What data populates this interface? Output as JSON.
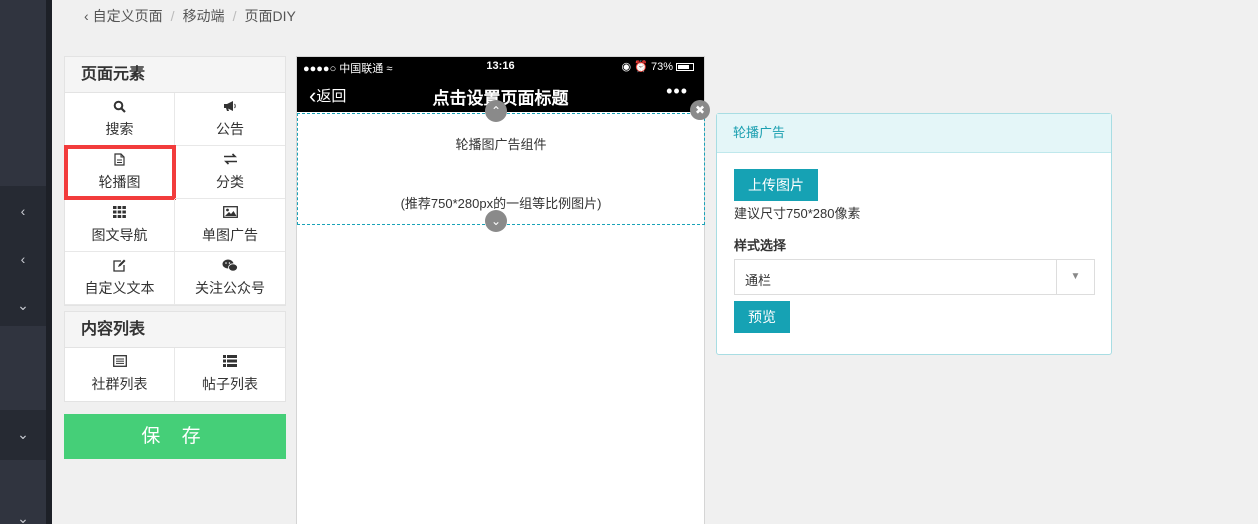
{
  "breadcrumb": {
    "back_icon": "chevron-left-icon",
    "items": [
      "自定义页面",
      "移动端",
      "页面DIY"
    ]
  },
  "page_elements": {
    "title": "页面元素",
    "items": [
      {
        "label": "搜索",
        "icon": "search-icon"
      },
      {
        "label": "公告",
        "icon": "bullhorn-icon"
      },
      {
        "label": "轮播图",
        "icon": "file-icon"
      },
      {
        "label": "分类",
        "icon": "exchange-icon"
      },
      {
        "label": "图文导航",
        "icon": "th-icon"
      },
      {
        "label": "单图广告",
        "icon": "picture-icon"
      },
      {
        "label": "自定义文本",
        "icon": "edit-icon"
      },
      {
        "label": "关注公众号",
        "icon": "wechat-icon"
      }
    ]
  },
  "content_list": {
    "title": "内容列表",
    "items": [
      {
        "label": "社群列表",
        "icon": "list-alt-icon"
      },
      {
        "label": "帖子列表",
        "icon": "list-icon"
      }
    ]
  },
  "save_label": "保 存",
  "phone": {
    "carrier": "●●●●○ 中国联通",
    "time": "13:16",
    "battery": "73%",
    "back_label": "返回",
    "title": "点击设置页面标题",
    "more": "•••",
    "carousel_title": "轮播图广告组件",
    "carousel_hint": "(推荐750*280px的一组等比例图片)"
  },
  "settings": {
    "title": "轮播广告",
    "upload_label": "上传图片",
    "size_hint": "建议尺寸750*280像素",
    "style_label": "样式选择",
    "style_value": "通栏",
    "preview_label": "预览"
  },
  "colors": {
    "save": "#45cf78",
    "accent": "#16a2b4",
    "highlight": "#f23c3c"
  }
}
